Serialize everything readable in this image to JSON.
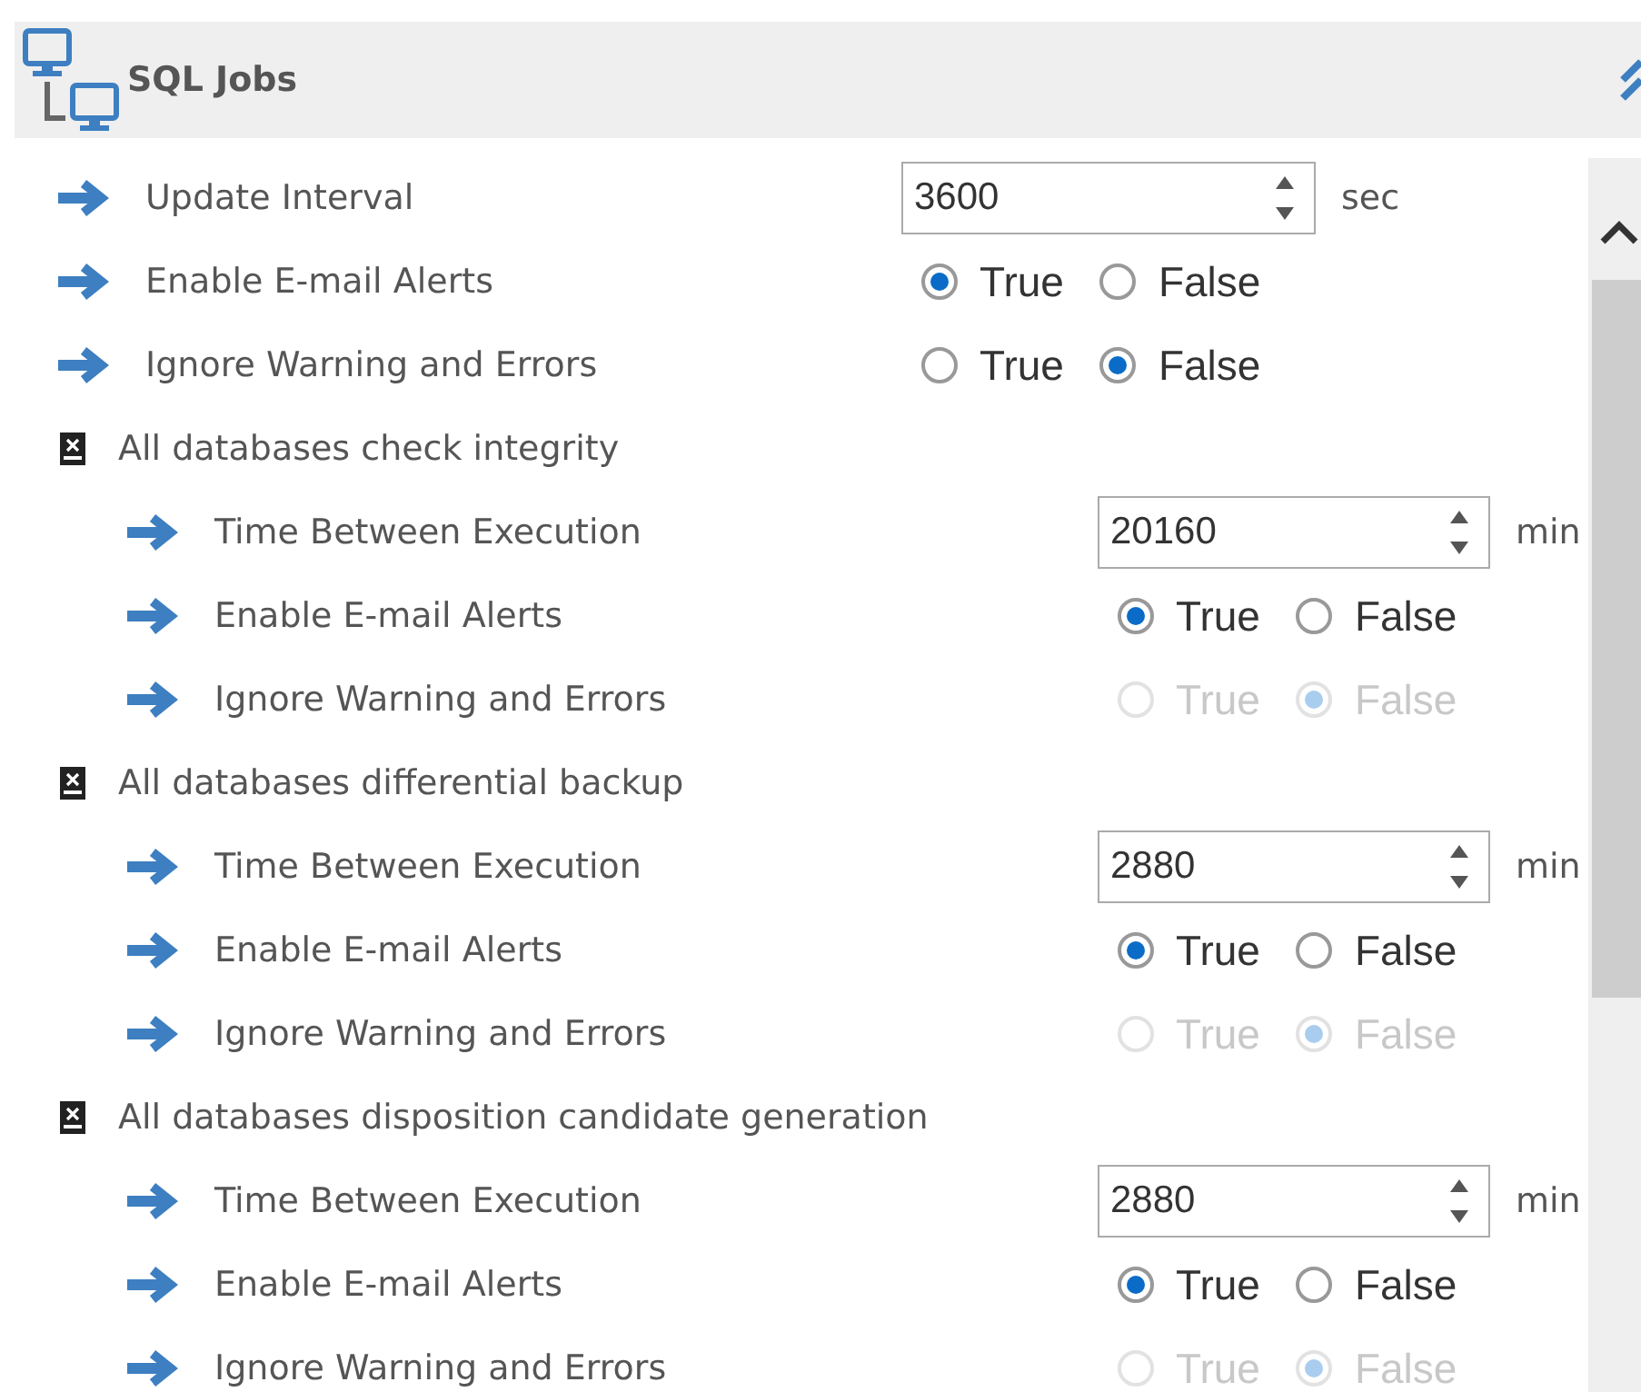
{
  "panel": {
    "title": "SQL Jobs"
  },
  "settings": [
    {
      "kind": "number",
      "label": "Update Interval",
      "value": "3600",
      "unit": "sec"
    },
    {
      "kind": "boolean",
      "label": "Enable E-mail Alerts",
      "disabled": false,
      "options": [
        {
          "label": "True",
          "selected": true
        },
        {
          "label": "False",
          "selected": false
        }
      ]
    },
    {
      "kind": "boolean",
      "label": "Ignore Warning and Errors",
      "disabled": false,
      "options": [
        {
          "label": "True",
          "selected": false
        },
        {
          "label": "False",
          "selected": true
        }
      ]
    }
  ],
  "jobs": [
    {
      "name": "All databases check integrity",
      "settings": [
        {
          "kind": "number",
          "label": "Time Between Execution",
          "value": "20160",
          "unit": "min"
        },
        {
          "kind": "boolean",
          "label": "Enable E-mail Alerts",
          "disabled": false,
          "options": [
            {
              "label": "True",
              "selected": true
            },
            {
              "label": "False",
              "selected": false
            }
          ]
        },
        {
          "kind": "boolean",
          "label": "Ignore Warning and Errors",
          "disabled": true,
          "options": [
            {
              "label": "True",
              "selected": false
            },
            {
              "label": "False",
              "selected": true
            }
          ]
        }
      ]
    },
    {
      "name": "All databases differential backup",
      "settings": [
        {
          "kind": "number",
          "label": "Time Between Execution",
          "value": "2880",
          "unit": "min"
        },
        {
          "kind": "boolean",
          "label": "Enable E-mail Alerts",
          "disabled": false,
          "options": [
            {
              "label": "True",
              "selected": true
            },
            {
              "label": "False",
              "selected": false
            }
          ]
        },
        {
          "kind": "boolean",
          "label": "Ignore Warning and Errors",
          "disabled": true,
          "options": [
            {
              "label": "True",
              "selected": false
            },
            {
              "label": "False",
              "selected": true
            }
          ]
        }
      ]
    },
    {
      "name": "All databases disposition candidate generation",
      "settings": [
        {
          "kind": "number",
          "label": "Time Between Execution",
          "value": "2880",
          "unit": "min"
        },
        {
          "kind": "boolean",
          "label": "Enable E-mail Alerts",
          "disabled": false,
          "options": [
            {
              "label": "True",
              "selected": true
            },
            {
              "label": "False",
              "selected": false
            }
          ]
        },
        {
          "kind": "boolean",
          "label": "Ignore Warning and Errors",
          "disabled": true,
          "options": [
            {
              "label": "True",
              "selected": false
            },
            {
              "label": "False",
              "selected": true
            }
          ]
        }
      ]
    }
  ]
}
